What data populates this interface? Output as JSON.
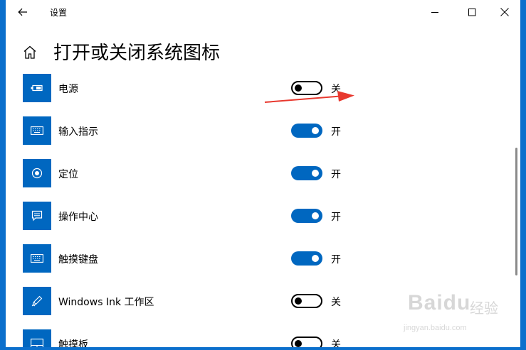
{
  "window": {
    "title": "设置",
    "colors": {
      "frame": "#0b6fcc",
      "accent": "#0067c0"
    },
    "controls": [
      "back-arrow-icon",
      "minimize-icon",
      "maximize-icon",
      "close-icon"
    ]
  },
  "header": {
    "home_icon": "home-icon",
    "title": "打开或关闭系统图标"
  },
  "items": [
    {
      "label": "电源",
      "icon": "battery-icon",
      "state_label": "关",
      "on": false
    },
    {
      "label": "输入指示",
      "icon": "keyboard-icon",
      "state_label": "开",
      "on": true
    },
    {
      "label": "定位",
      "icon": "location-icon",
      "state_label": "开",
      "on": true
    },
    {
      "label": "操作中心",
      "icon": "action-center-icon",
      "state_label": "开",
      "on": true
    },
    {
      "label": "触摸键盘",
      "icon": "touch-keyboard-icon",
      "state_label": "开",
      "on": true
    },
    {
      "label": "Windows Ink 工作区",
      "icon": "pen-icon",
      "state_label": "关",
      "on": false
    },
    {
      "label": "触摸板",
      "icon": "touchpad-icon",
      "state_label": "关",
      "on": false
    }
  ],
  "annotation": {
    "arrow_color": "#e8382e"
  },
  "watermark": {
    "brand": "Baidu",
    "suffix": "经验",
    "url": "jingyan.baidu.com"
  }
}
